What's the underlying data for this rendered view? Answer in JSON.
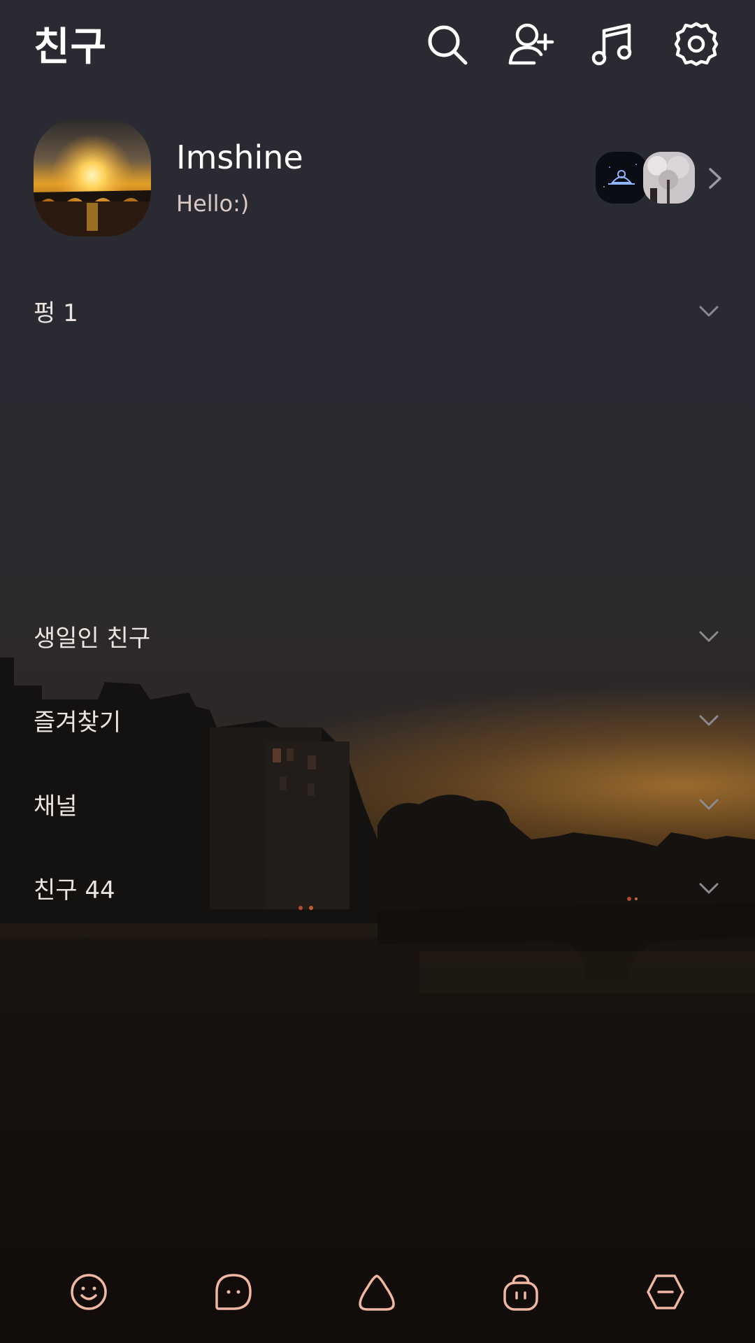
{
  "header": {
    "title": "친구",
    "icons": [
      "search-icon",
      "add-friend-icon",
      "music-icon",
      "settings-icon"
    ]
  },
  "profile": {
    "name": "Imshine",
    "status": "Hello:)"
  },
  "sections": [
    {
      "label": "펑 1"
    },
    {
      "label": "생일인 친구"
    },
    {
      "label": "즐겨찾기"
    },
    {
      "label": "채널"
    },
    {
      "label": "친구 44"
    }
  ],
  "bottom_nav": {
    "items": [
      "friends-tab-icon",
      "chats-tab-icon",
      "view-tab-icon",
      "shopping-tab-icon",
      "more-tab-icon"
    ],
    "active_color": "#f0b7a2"
  },
  "colors": {
    "text": "#ffffff",
    "section_text": "#ece4e0",
    "accent": "#f0b7a2"
  }
}
